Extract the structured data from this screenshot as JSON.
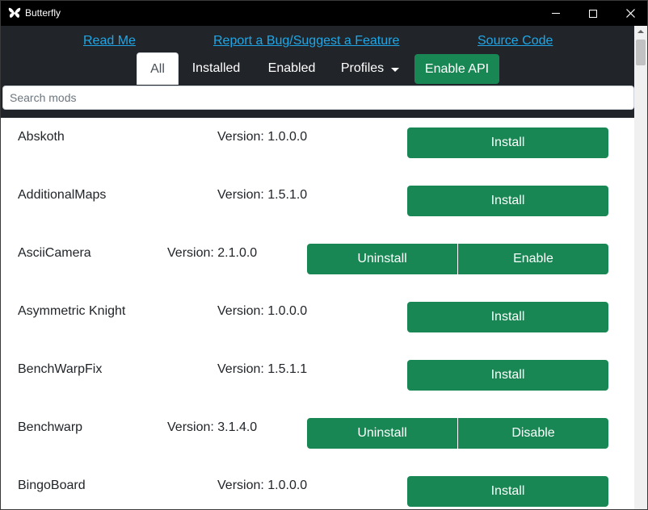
{
  "window": {
    "title": "Butterfly",
    "controls": {
      "minimize": "minimize",
      "maximize": "maximize",
      "close": "✕"
    }
  },
  "links": {
    "readme": "Read Me",
    "bug": "Report a Bug/Suggest a Feature",
    "source": "Source Code"
  },
  "tabs": {
    "all": "All",
    "installed": "Installed",
    "enabled": "Enabled",
    "profiles": "Profiles",
    "api": "Enable API"
  },
  "search": {
    "placeholder": "Search mods",
    "value": ""
  },
  "colors": {
    "header_bg": "#212529",
    "accent_green": "#198754",
    "link": "#1ea7e8"
  },
  "mods": [
    {
      "name": "Abskoth",
      "version": "Version: 1.0.0.0",
      "installed": false,
      "button": "Install"
    },
    {
      "name": "AdditionalMaps",
      "version": "Version: 1.5.1.0",
      "installed": false,
      "button": "Install"
    },
    {
      "name": "AsciiCamera",
      "version": "Version: 2.1.0.0",
      "installed": true,
      "buttons": [
        "Uninstall",
        "Enable"
      ]
    },
    {
      "name": "Asymmetric Knight",
      "version": "Version: 1.0.0.0",
      "installed": false,
      "button": "Install"
    },
    {
      "name": "BenchWarpFix",
      "version": "Version: 1.5.1.1",
      "installed": false,
      "button": "Install"
    },
    {
      "name": "Benchwarp",
      "version": "Version: 3.1.4.0",
      "installed": true,
      "buttons": [
        "Uninstall",
        "Disable"
      ]
    },
    {
      "name": "BingoBoard",
      "version": "Version: 1.0.0.0",
      "installed": false,
      "button": "Install"
    }
  ]
}
